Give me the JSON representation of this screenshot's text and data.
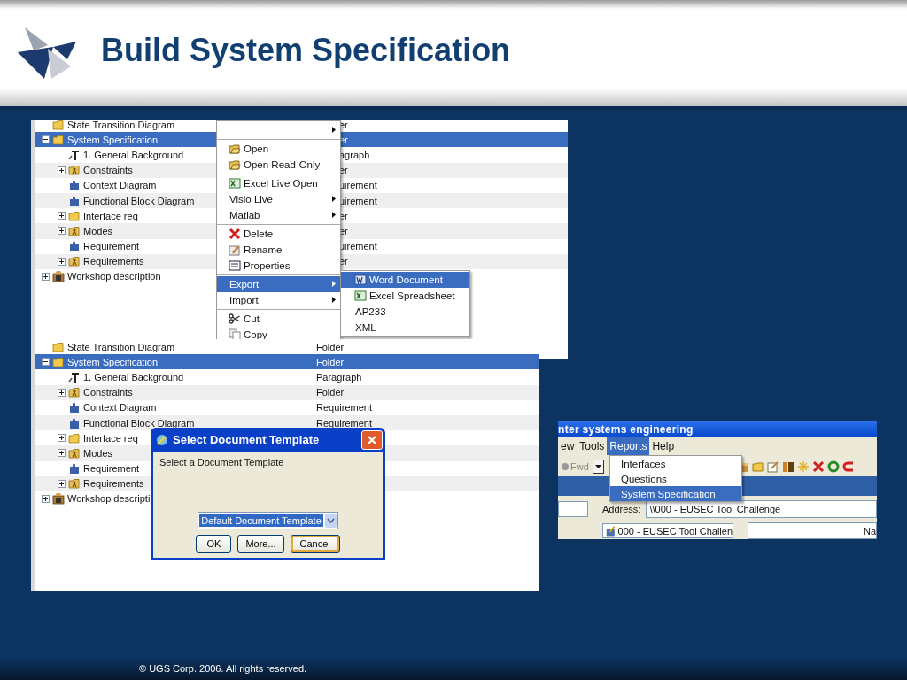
{
  "slide": {
    "title": "Build System Specification",
    "footer": "© UGS Corp. 2006. All rights reserved."
  },
  "explorer_top": {
    "tree": [
      {
        "name": "State Transition Diagram",
        "kind": "folder",
        "type": "er",
        "selected": false
      },
      {
        "name": "System Specification",
        "kind": "folder",
        "type": "er",
        "selected": true,
        "expanded": true,
        "children": [
          {
            "name": "1. General Background",
            "kind": "paragraph",
            "type": "agraph",
            "selected": false
          },
          {
            "name": "Constraints",
            "kind": "package",
            "type": "er",
            "selected": false,
            "expanded": false
          },
          {
            "name": "Context Diagram",
            "kind": "requirement",
            "type": "uirement",
            "selected": false
          },
          {
            "name": "Functional Block Diagram",
            "kind": "requirement",
            "type": "uirement",
            "selected": false
          },
          {
            "name": "Interface req",
            "kind": "folder",
            "type": "er",
            "selected": false,
            "expanded": false
          },
          {
            "name": "Modes",
            "kind": "package",
            "type": "er",
            "selected": false,
            "expanded": false
          },
          {
            "name": "Requirement",
            "kind": "requirement",
            "type": "uirement",
            "selected": false
          },
          {
            "name": "Requirements",
            "kind": "package",
            "type": "er",
            "selected": false,
            "expanded": false
          }
        ]
      },
      {
        "name": "Workshop description",
        "kind": "workshop",
        "selected": false,
        "expanded": false
      }
    ]
  },
  "context_menu": {
    "groups": [
      [
        {
          "submenu": true,
          "selected": false
        }
      ],
      [
        {
          "label": "Open",
          "kind": "open",
          "submenu": false,
          "selected": false
        },
        {
          "label": "Open Read-Only",
          "kind": "open",
          "submenu": false,
          "selected": false
        }
      ],
      [
        {
          "label": "Excel Live Open",
          "kind": "excel",
          "submenu": false,
          "selected": false
        },
        {
          "label": "Visio Live",
          "submenu": true,
          "selected": false
        },
        {
          "label": "Matlab",
          "submenu": true,
          "selected": false
        }
      ],
      [
        {
          "label": "Delete",
          "kind": "delete",
          "submenu": false,
          "selected": false
        },
        {
          "label": "Rename",
          "kind": "rename",
          "submenu": false,
          "selected": false
        },
        {
          "label": "Properties",
          "kind": "properties",
          "submenu": false,
          "selected": false
        }
      ],
      [
        {
          "label": "Export",
          "submenu": true,
          "selected": true
        },
        {
          "label": "Import",
          "submenu": true,
          "selected": false
        }
      ],
      [
        {
          "label": "Cut",
          "kind": "cut",
          "submenu": false,
          "selected": false
        },
        {
          "label": "Copy",
          "kind": "copy",
          "submenu": false,
          "selected": false
        }
      ]
    ]
  },
  "export_submenu": {
    "items": [
      {
        "label": "Word Document",
        "kind": "word",
        "selected": true
      },
      {
        "label": "Excel Spreadsheet",
        "kind": "excel",
        "selected": false
      },
      {
        "label": "AP233",
        "selected": false
      },
      {
        "label": "XML",
        "selected": false
      }
    ]
  },
  "explorer_bottom": {
    "tree": [
      {
        "name": "State Transition Diagram",
        "kind": "folder",
        "type": "Folder",
        "selected": false
      },
      {
        "name": "System Specification",
        "kind": "folder",
        "type": "Folder",
        "selected": true,
        "expanded": true,
        "children": [
          {
            "name": "1. General Background",
            "kind": "paragraph",
            "type": "Paragraph",
            "selected": false
          },
          {
            "name": "Constraints",
            "kind": "package",
            "type": "Folder",
            "selected": false,
            "expanded": false
          },
          {
            "name": "Context Diagram",
            "kind": "requirement",
            "type": "Requirement",
            "selected": false
          },
          {
            "name": "Functional Block Diagram",
            "kind": "requirement",
            "type": "Requirement",
            "selected": false
          },
          {
            "name": "Interface req",
            "kind": "folder",
            "selected": false,
            "expanded": false
          },
          {
            "name": "Modes",
            "kind": "package",
            "selected": false,
            "expanded": false
          },
          {
            "name": "Requirement",
            "kind": "requirement",
            "selected": false
          },
          {
            "name": "Requirements",
            "kind": "package",
            "selected": false,
            "expanded": false
          }
        ]
      },
      {
        "name": "Workshop descripti",
        "kind": "workshop",
        "selected": false,
        "expanded": false
      }
    ]
  },
  "dialog": {
    "title": "Select Document Template",
    "prompt": "Select a Document Template",
    "template": {
      "value": "Default Document Template"
    },
    "buttons": [
      {
        "label": "OK",
        "focused": false
      },
      {
        "label": "More...",
        "focused": false
      },
      {
        "label": "Cancel",
        "focused": true
      }
    ]
  },
  "app_window": {
    "title": "nter systems engineering",
    "menu": [
      {
        "label": "ew",
        "selected": false
      },
      {
        "label": "Tools",
        "selected": false
      },
      {
        "label": "Reports",
        "selected": true
      },
      {
        "label": "Help",
        "selected": false
      }
    ],
    "toolbar": {
      "forward": "Fwd"
    },
    "reports_menu": [
      {
        "label": "Interfaces",
        "selected": false
      },
      {
        "label": "Questions",
        "selected": false
      },
      {
        "label": "System Specification",
        "selected": true
      }
    ],
    "address": {
      "label": "Address:",
      "value": "\\\\000 - EUSEC Tool Challenge"
    },
    "tree_item": "000 - EUSEC Tool Challen",
    "column_header": "Na"
  }
}
